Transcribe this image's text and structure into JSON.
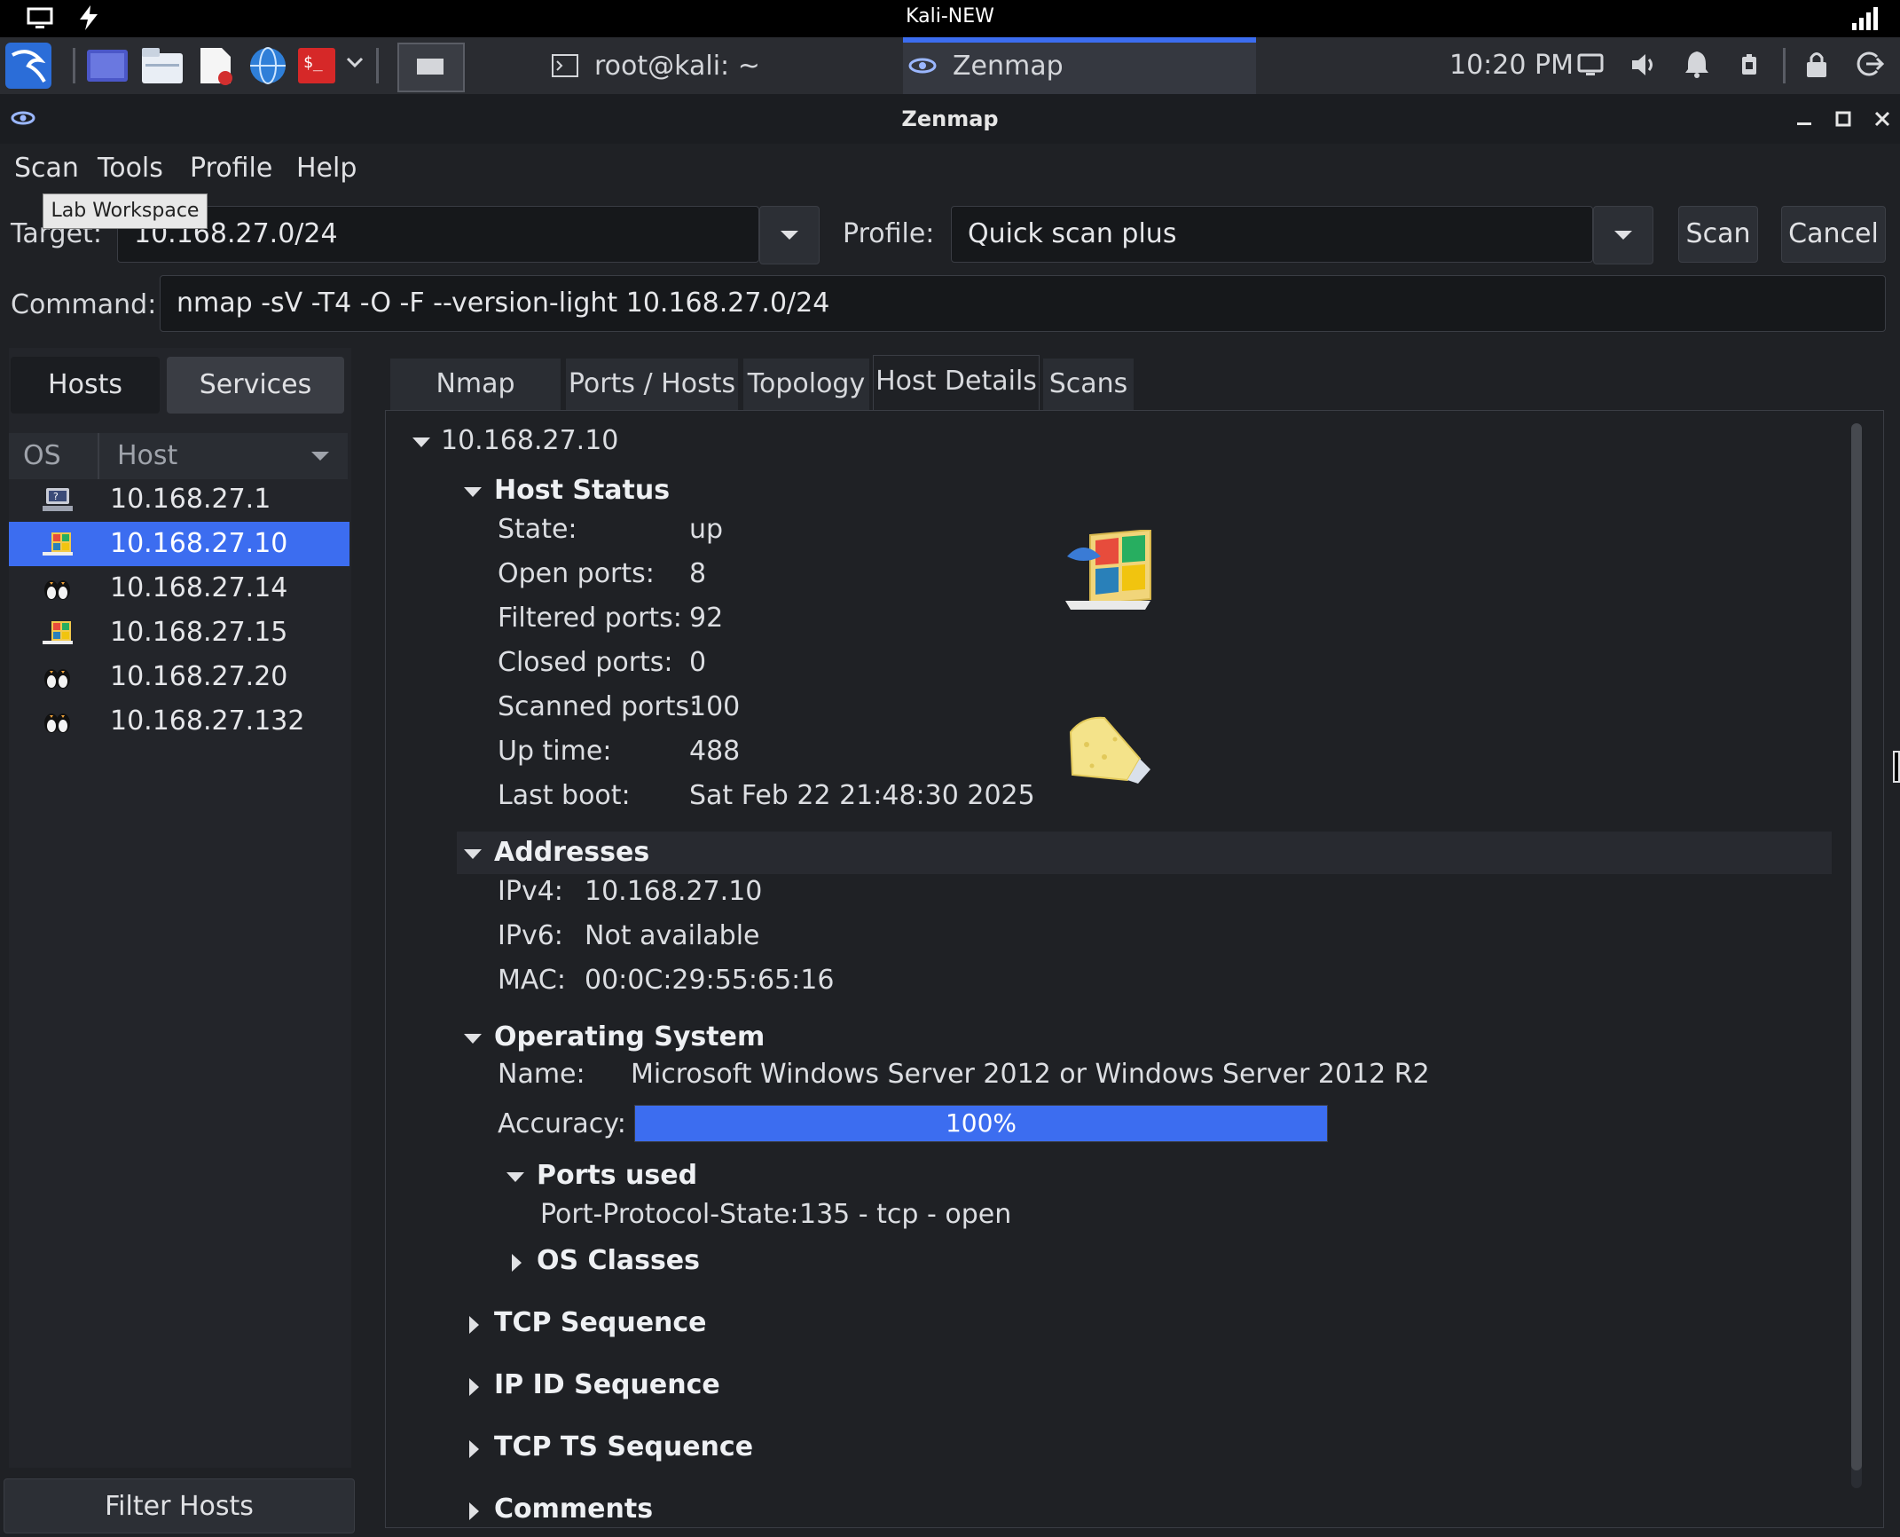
{
  "system_bar": {
    "title": "Kali-NEW"
  },
  "taskbar": {
    "tasks": [
      {
        "label": "root@kali: ~"
      },
      {
        "label": "Zenmap"
      }
    ],
    "clock": "10:20 PM"
  },
  "window": {
    "title": "Zenmap"
  },
  "menu": {
    "items": [
      "Scan",
      "Tools",
      "Profile",
      "Help"
    ]
  },
  "tooltip": "Lab Workspace",
  "target": {
    "label": "Target:",
    "value": "10.168.27.0/24"
  },
  "profile": {
    "label": "Profile:",
    "value": "Quick scan plus"
  },
  "buttons": {
    "scan": "Scan",
    "cancel": "Cancel",
    "filter_hosts": "Filter Hosts"
  },
  "command": {
    "label": "Command:",
    "value": "nmap -sV -T4 -O -F --version-light 10.168.27.0/24"
  },
  "left_panel": {
    "toggles": [
      "Hosts",
      "Services"
    ],
    "columns": {
      "os": "OS",
      "host": "Host"
    },
    "hosts": [
      {
        "ip": "10.168.27.1",
        "os_icon": "unknown-os-icon"
      },
      {
        "ip": "10.168.27.10",
        "os_icon": "windows-os-icon",
        "selected": true
      },
      {
        "ip": "10.168.27.14",
        "os_icon": "linux-os-icon"
      },
      {
        "ip": "10.168.27.15",
        "os_icon": "windows-os-icon"
      },
      {
        "ip": "10.168.27.20",
        "os_icon": "linux-os-icon"
      },
      {
        "ip": "10.168.27.132",
        "os_icon": "linux-os-icon"
      }
    ]
  },
  "tabs": [
    "Nmap Output",
    "Ports / Hosts",
    "Topology",
    "Host Details",
    "Scans"
  ],
  "details": {
    "host": "10.168.27.10",
    "host_status": {
      "title": "Host Status",
      "rows": [
        {
          "k": "State:",
          "v": "up"
        },
        {
          "k": "Open ports:",
          "v": "8"
        },
        {
          "k": "Filtered ports:",
          "v": "92"
        },
        {
          "k": "Closed ports:",
          "v": "0"
        },
        {
          "k": "Scanned ports:",
          "v": "100"
        },
        {
          "k": "Up time:",
          "v": "488"
        },
        {
          "k": "Last boot:",
          "v": "Sat Feb 22 21:48:30 2025"
        }
      ]
    },
    "addresses": {
      "title": "Addresses",
      "rows": [
        {
          "k": "IPv4:",
          "v": "10.168.27.10"
        },
        {
          "k": "IPv6:",
          "v": "Not available"
        },
        {
          "k": "MAC:",
          "v": "00:0C:29:55:65:16"
        }
      ]
    },
    "os": {
      "title": "Operating System",
      "name_label": "Name:",
      "name": "Microsoft Windows Server 2012 or Windows Server 2012 R2",
      "accuracy_label": "Accuracy:",
      "accuracy": "100%",
      "accuracy_fraction": 1.0,
      "ports_used_title": "Ports used",
      "pps_label": "Port-Protocol-State:",
      "pps_value": "135 - tcp - open",
      "os_classes": "OS Classes"
    },
    "collapsed": [
      "TCP Sequence",
      "IP ID Sequence",
      "TCP TS Sequence",
      "Comments"
    ]
  },
  "colors": {
    "accent": "#3c6df0",
    "background": "#1f2125"
  }
}
